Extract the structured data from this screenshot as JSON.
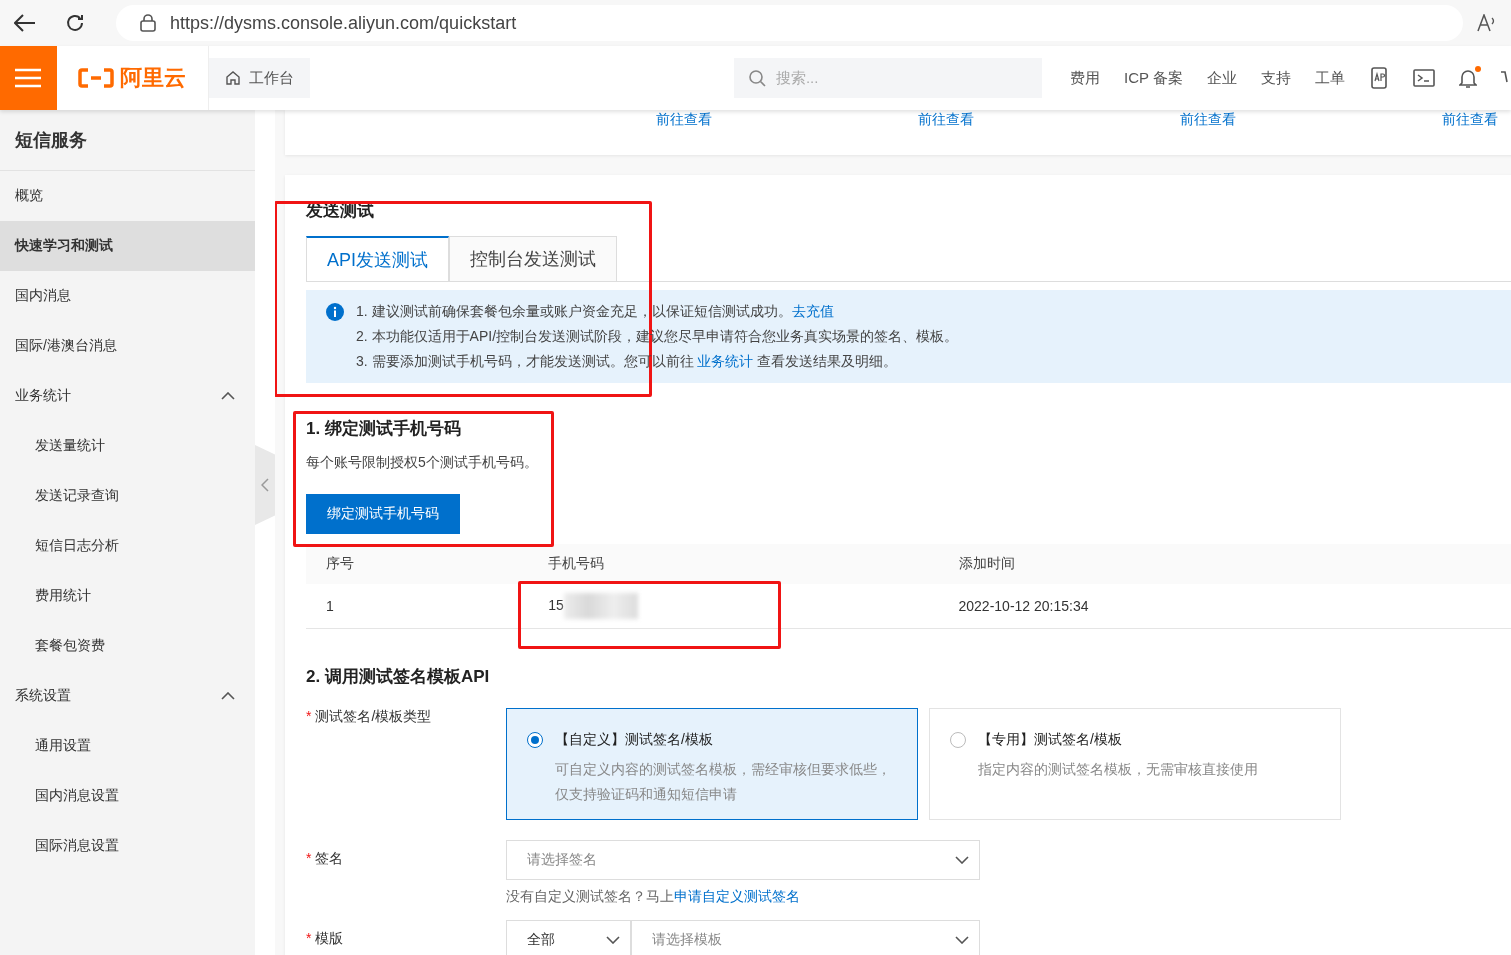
{
  "browser": {
    "url": "https://dysms.console.aliyun.com/quickstart"
  },
  "header": {
    "logo": "阿里云",
    "workbench": "工作台",
    "search_placeholder": "搜索...",
    "nav": [
      "费用",
      "ICP 备案",
      "企业",
      "支持",
      "工单"
    ],
    "bell_dot": true
  },
  "sidebar": {
    "title": "短信服务",
    "items": [
      {
        "label": "概览",
        "selected": false
      },
      {
        "label": "快速学习和测试",
        "selected": true
      },
      {
        "label": "国内消息",
        "selected": false
      },
      {
        "label": "国际/港澳台消息",
        "selected": false
      },
      {
        "label": "业务统计",
        "selected": false,
        "expanded": true,
        "children": [
          {
            "label": "发送量统计",
            "selected": false
          },
          {
            "label": "发送记录查询",
            "selected": false
          },
          {
            "label": "短信日志分析",
            "selected": false
          },
          {
            "label": "费用统计",
            "selected": false
          },
          {
            "label": "套餐包资费",
            "selected": false
          }
        ]
      },
      {
        "label": "系统设置",
        "selected": false,
        "expanded": true,
        "children": [
          {
            "label": "通用设置",
            "selected": false
          },
          {
            "label": "国内消息设置",
            "selected": false
          },
          {
            "label": "国际消息设置",
            "selected": false
          }
        ]
      }
    ]
  },
  "top_links": [
    "前往查看",
    "前往查看",
    "前往查看",
    "前往查看"
  ],
  "send_test": {
    "title": "发送测试",
    "highlighted": true,
    "tabs": [
      {
        "label": "API发送测试",
        "selected": true
      },
      {
        "label": "控制台发送测试",
        "selected": false
      }
    ],
    "notice": [
      [
        {
          "text": "1. 建议测试前确保套餐包余量或账户资金充足，以保证短信测试成功。",
          "link": false
        },
        {
          "text": "去充值",
          "link": true
        }
      ],
      [
        {
          "text": "2. 本功能仅适用于API/控制台发送测试阶段，建议您尽早申请符合您业务真实场景的签名、模板。",
          "link": false
        }
      ],
      [
        {
          "text": "3. 需要添加测试手机号码，才能发送测试。您可以前往 ",
          "link": false
        },
        {
          "text": "业务统计",
          "link": true
        },
        {
          "text": " 查看发送结果及明细。",
          "link": false
        }
      ]
    ]
  },
  "step1": {
    "title": "1. 绑定测试手机号码",
    "description": "每个账号限制授权5个测试手机号码。",
    "button": "绑定测试手机号码",
    "highlighted": true
  },
  "phones": {
    "columns": [
      "序号",
      "手机号码",
      "添加时间"
    ],
    "rows": [
      {
        "index": "1",
        "phone": "15",
        "phone_blurred": true,
        "phone_highlighted": true,
        "added": "2022-10-12 20:15:34"
      }
    ]
  },
  "step2": {
    "title": "2. 调用测试签名模板API",
    "required_mark": [
      "*",
      "*",
      "*"
    ],
    "type_label": "测试签名/模板类型",
    "types": [
      {
        "title": "【自定义】测试签名/模板",
        "description": "可自定义内容的测试签名模板，需经审核但要求低些，仅支持验证码和通知短信申请",
        "selected": true
      },
      {
        "title": "【专用】测试签名/模板",
        "description": "指定内容的测试签名模板，无需审核直接使用",
        "selected": false
      }
    ],
    "sign_label": "签名",
    "sign_placeholder": "请选择签名",
    "sign_help": [
      {
        "text": "没有自定义测试签名？马上",
        "link": false
      },
      {
        "text": "申请自定义测试签名",
        "link": true
      }
    ],
    "template_label": "模版",
    "template_filter": "全部",
    "template_placeholder": "请选择模板"
  }
}
